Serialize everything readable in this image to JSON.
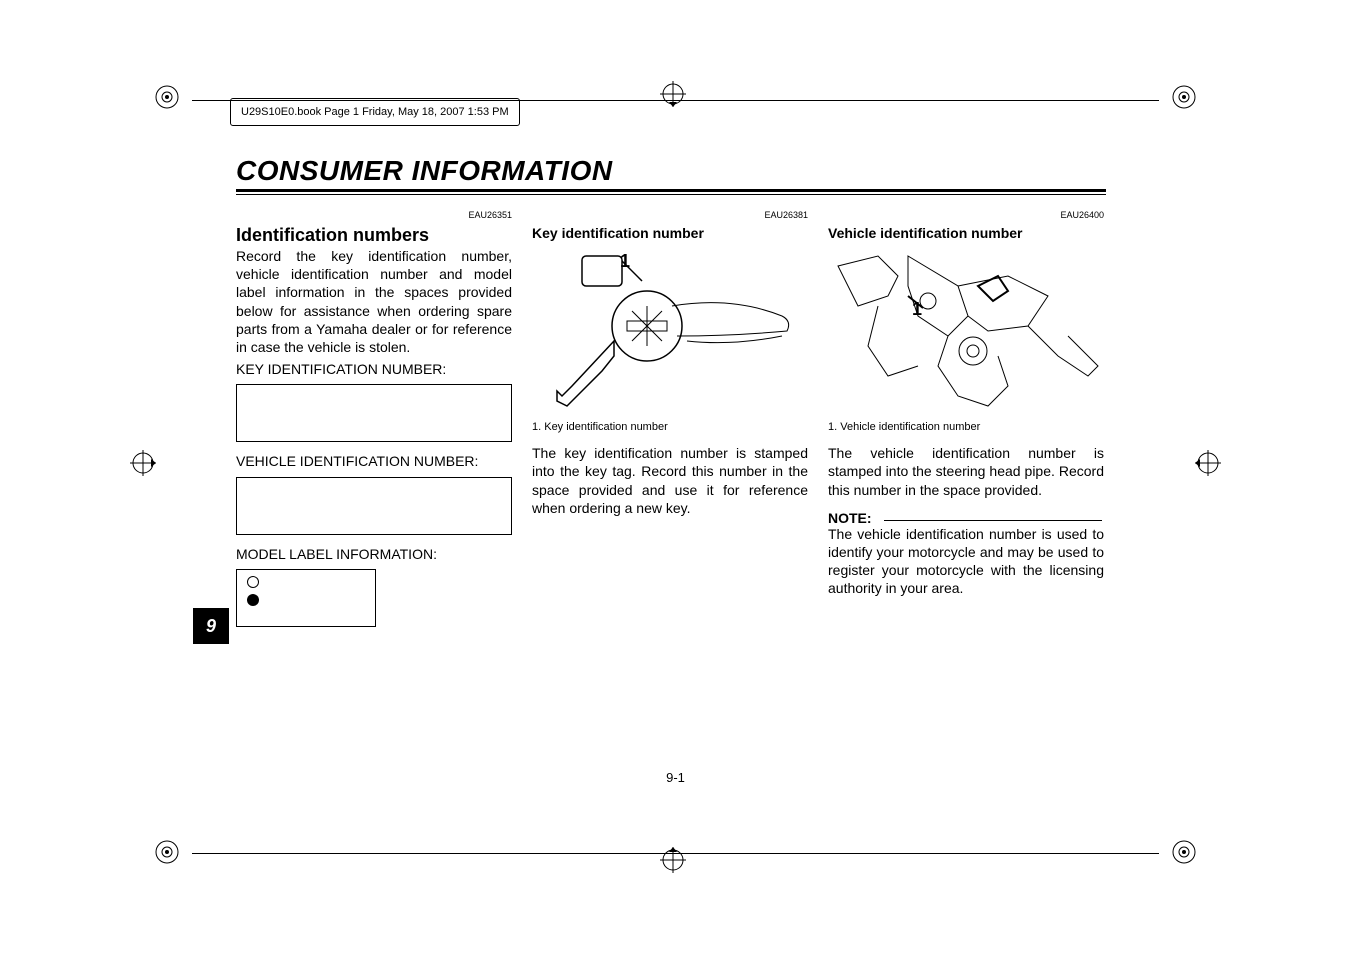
{
  "header": {
    "book_info": "U29S10E0.book  Page 1  Friday, May 18, 2007  1:53 PM"
  },
  "chapter": {
    "title": "CONSUMER INFORMATION"
  },
  "tab": {
    "number": "9"
  },
  "footer": {
    "page": "9-1"
  },
  "col1": {
    "refcode": "EAU26351",
    "heading": "Identification numbers",
    "body": "Record the key identification number, vehicle identification number and model label information in the spaces provided below for assistance when ordering spare parts from a Yamaha dealer or for reference in case the vehicle is stolen.",
    "label1": "KEY IDENTIFICATION NUMBER:",
    "label2": "VEHICLE IDENTIFICATION NUMBER:",
    "label3": "MODEL LABEL INFORMATION:"
  },
  "col2": {
    "refcode": "EAU26381",
    "heading": "Key identification number",
    "fig_callout": "1",
    "caption": "1. Key identification number",
    "body": "The key identification number is stamped into the key tag. Record this number in the space provided and use it for reference when ordering a new key."
  },
  "col3": {
    "refcode": "EAU26400",
    "heading": "Vehicle identification number",
    "fig_callout": "1",
    "caption": "1. Vehicle identification number",
    "body": "The vehicle identification number is stamped into the steering head pipe. Record this number in the space provided.",
    "note_label": "NOTE:",
    "note_body": "The vehicle identification number is used to identify your motorcycle and may be used to register your motorcycle with the licensing authority in your area."
  }
}
